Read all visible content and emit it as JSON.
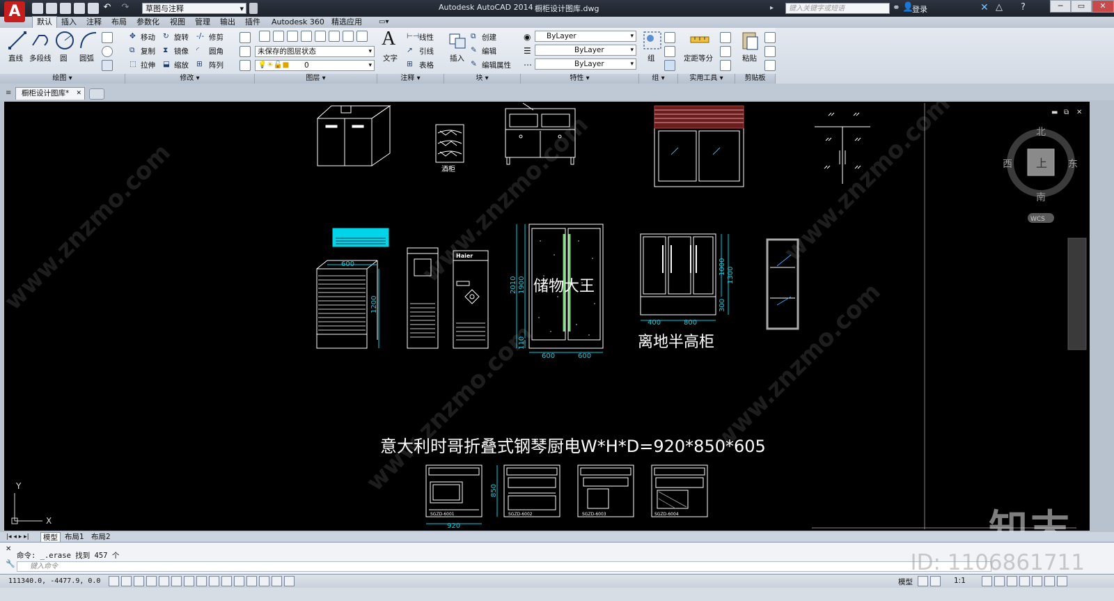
{
  "titlebar": {
    "workspace": "草图与注释",
    "app_title": "Autodesk AutoCAD 2014",
    "file_title": "橱柜设计图库.dwg",
    "search_placeholder": "键入关键字或短语",
    "login": "登录"
  },
  "ribbon_tabs": [
    "默认",
    "插入",
    "注释",
    "布局",
    "参数化",
    "视图",
    "管理",
    "输出",
    "插件",
    "Autodesk 360",
    "精选应用"
  ],
  "ribbon": {
    "draw": {
      "line": "直线",
      "polyline": "多段线",
      "circle": "圆",
      "arc": "圆弧",
      "title": "绘图 ▾"
    },
    "modify": {
      "move": "移动",
      "rotate": "旋转",
      "trim": "修剪",
      "copy": "复制",
      "mirror": "镜像",
      "fillet": "圆角",
      "stretch": "拉伸",
      "scale": "缩放",
      "array": "阵列",
      "title": "修改 ▾"
    },
    "layers": {
      "state": "未保存的图层状态",
      "layer": "0",
      "title": "图层 ▾"
    },
    "annotation": {
      "text": "文字",
      "linear": "线性",
      "leader": "引线",
      "table": "表格",
      "title": "注释 ▾"
    },
    "block": {
      "insert": "插入",
      "create": "创建",
      "edit": "编辑",
      "edit_attr": "编辑属性",
      "title": "块 ▾"
    },
    "properties": {
      "color": "ByLayer",
      "linetype": "ByLayer",
      "lineweight": "ByLayer",
      "title": "特性 ▾"
    },
    "groups": {
      "group": "组",
      "title": "组 ▾"
    },
    "utilities": {
      "measure": "定距等分",
      "title": "实用工具 ▾"
    },
    "clipboard": {
      "paste": "粘贴",
      "title": "剪贴板"
    }
  },
  "doc_tab": "橱柜设计图库*",
  "drawing": {
    "wine_rack_label": "酒柜",
    "ac_dim_width": "600",
    "ac_dim_height": "1200",
    "fridge_brand": "Haier",
    "storage_label": "储物大王",
    "storage_h1": "2010",
    "storage_h2": "1900",
    "storage_h3": "110",
    "storage_w1": "600",
    "storage_w2": "600",
    "half_h1": "1000",
    "half_h2": "1300",
    "half_h3": "300",
    "half_w1": "400",
    "half_w2": "800",
    "half_label": "离地半高柜",
    "stove_title": "意大利时哥折叠式钢琴厨电W*H*D=920*850*605",
    "stove_height": "850",
    "stove_width": "920",
    "stove_models": [
      "SGZD-6001",
      "SGZD-6002",
      "SGZD-6003",
      "SGZD-6004"
    ],
    "ucs_y": "Y",
    "ucs_x": "X"
  },
  "viewcube": {
    "north": "北",
    "south": "南",
    "east": "东",
    "west": "西",
    "top": "上",
    "wcs": "WCS"
  },
  "layout_tabs": [
    "模型",
    "布局1",
    "布局2"
  ],
  "command": {
    "history": "命令: _.erase 找到 457 个",
    "placeholder": "键入命令"
  },
  "status": {
    "coords": "111340.0, -4477.9, 0.0",
    "model": "模型",
    "scale": "1:1"
  },
  "watermark": {
    "brand": "知末",
    "id": "ID: 1106861711",
    "site": "www.znzmo.com"
  }
}
